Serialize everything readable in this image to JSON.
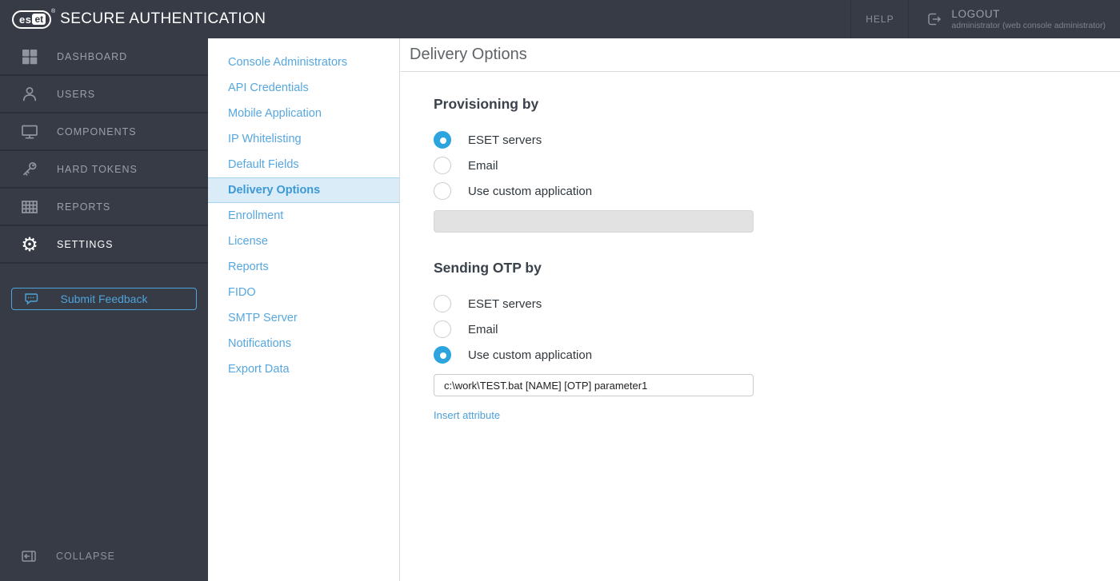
{
  "topbar": {
    "logo_es": "es",
    "logo_et": "et",
    "logo_reg": "®",
    "brand": "SECURE AUTHENTICATION",
    "help_label": "HELP",
    "logout_label": "LOGOUT",
    "logout_sub": "administrator (web console administrator)"
  },
  "sidebar": {
    "items": [
      {
        "label": "DASHBOARD",
        "icon": "dashboard-icon",
        "active": false
      },
      {
        "label": "USERS",
        "icon": "users-icon",
        "active": false
      },
      {
        "label": "COMPONENTS",
        "icon": "components-icon",
        "active": false
      },
      {
        "label": "HARD TOKENS",
        "icon": "hard-tokens-icon",
        "active": false
      },
      {
        "label": "REPORTS",
        "icon": "reports-icon",
        "active": false
      },
      {
        "label": "SETTINGS",
        "icon": "settings-gear-icon",
        "active": true
      }
    ],
    "feedback_label": "Submit Feedback",
    "collapse_label": "COLLAPSE"
  },
  "settings_menu": {
    "items": [
      {
        "label": "Console Administrators",
        "active": false
      },
      {
        "label": "API Credentials",
        "active": false
      },
      {
        "label": "Mobile Application",
        "active": false
      },
      {
        "label": "IP Whitelisting",
        "active": false
      },
      {
        "label": "Default Fields",
        "active": false
      },
      {
        "label": "Delivery Options",
        "active": true
      },
      {
        "label": "Enrollment",
        "active": false
      },
      {
        "label": "License",
        "active": false
      },
      {
        "label": "Reports",
        "active": false
      },
      {
        "label": "FIDO",
        "active": false
      },
      {
        "label": "SMTP Server",
        "active": false
      },
      {
        "label": "Notifications",
        "active": false
      },
      {
        "label": "Export Data",
        "active": false
      }
    ]
  },
  "main": {
    "title": "Delivery Options",
    "provisioning": {
      "heading": "Provisioning by",
      "options": [
        {
          "label": "ESET servers",
          "selected": true
        },
        {
          "label": "Email",
          "selected": false
        },
        {
          "label": "Use custom application",
          "selected": false
        }
      ],
      "custom_app_value": "",
      "custom_app_disabled": true
    },
    "otp": {
      "heading": "Sending OTP by",
      "options": [
        {
          "label": "ESET servers",
          "selected": false
        },
        {
          "label": "Email",
          "selected": false
        },
        {
          "label": "Use custom application",
          "selected": true
        }
      ],
      "custom_app_value": "c:\\work\\TEST.bat [NAME] [OTP] parameter1",
      "insert_attribute_label": "Insert attribute"
    }
  },
  "colors": {
    "topbar_bg": "#363b45",
    "sidebar_divider": "#2b2f38",
    "inactive_nav_text": "#9aa0a7",
    "active_nav_text": "#ffffff",
    "accent_blue": "#2ca4dd",
    "menu_link_blue": "#57a7df",
    "active_menu_bg": "#daecf8",
    "active_menu_border": "#a6d2ef",
    "active_menu_text": "#3d99d6",
    "feedback_blue": "#4ea3da",
    "heading_text": "#3a424b",
    "title_text": "#5f6468",
    "divider_gray": "#d9d9d9",
    "disabled_input_bg": "#e2e2e2"
  }
}
